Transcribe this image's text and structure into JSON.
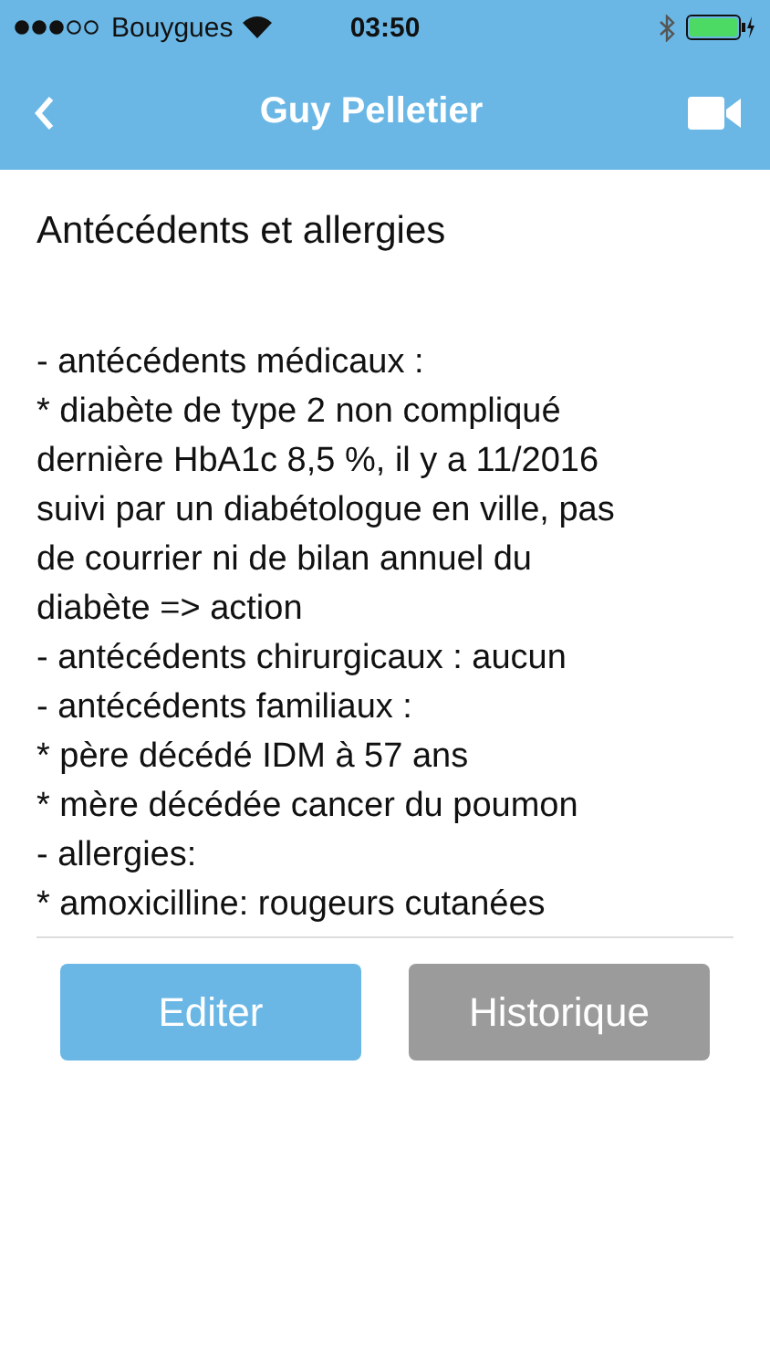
{
  "status_bar": {
    "carrier": "Bouygues",
    "time": "03:50"
  },
  "nav_bar": {
    "title": "Guy Pelletier"
  },
  "section": {
    "title": "Antécédents et allergies",
    "lines": [
      "- antécédents médicaux :",
      "* diabète de type 2 non compliqué",
      "dernière HbA1c 8,5 %, il y a 11/2016",
      "suivi par un diabétologue en ville, pas",
      "de courrier ni de bilan annuel du",
      "diabète => action",
      "- antécédents chirurgicaux : aucun",
      "- antécédents familiaux :",
      "* père décédé IDM à 57 ans",
      "* mère décédée cancer du poumon",
      "- allergies:",
      "* amoxicilline: rougeurs cutanées"
    ]
  },
  "buttons": [
    {
      "label": "Editer",
      "kind": "primary"
    },
    {
      "label": "Historique",
      "kind": "secondary"
    }
  ]
}
